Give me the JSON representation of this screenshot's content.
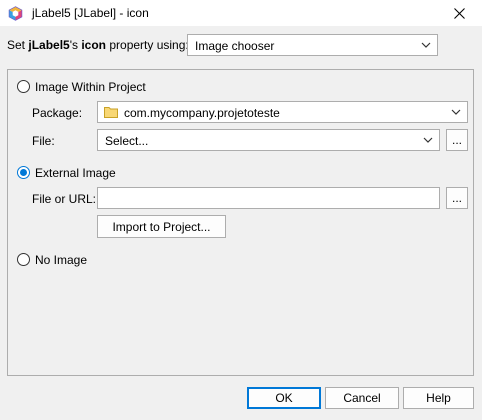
{
  "window": {
    "title": "jLabel5 [JLabel] - icon",
    "app_icon": "netbeans-cube-icon",
    "close_icon": "close-icon"
  },
  "property_row": {
    "prefix": "Set ",
    "component": "jLabel5",
    "middle": "'s ",
    "property": "icon",
    "suffix": " property using:",
    "editor_selected": "Image chooser"
  },
  "options": {
    "within_project": {
      "label": "Image Within Project",
      "selected": false,
      "package_label": "Package:",
      "package_value": "com.mycompany.projetoteste",
      "package_icon": "folder-icon",
      "file_label": "File:",
      "file_value": "Select...",
      "browse_label": "..."
    },
    "external": {
      "label": "External Image",
      "selected": true,
      "url_label": "File or URL:",
      "url_value": "",
      "browse_label": "...",
      "import_label": "Import to Project..."
    },
    "none": {
      "label": "No Image",
      "selected": false
    }
  },
  "buttons": {
    "ok": "OK",
    "cancel": "Cancel",
    "help": "Help"
  },
  "colors": {
    "accent": "#0078d7",
    "dialog_bg": "#f0f0f0",
    "border": "#adadad"
  }
}
